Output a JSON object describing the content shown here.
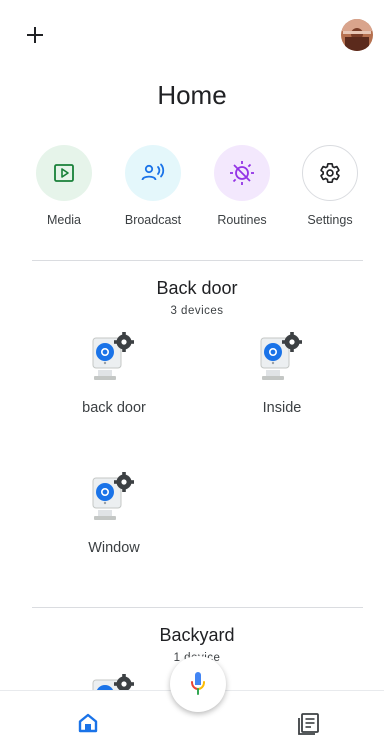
{
  "header": {
    "title": "Home"
  },
  "quick_actions": [
    {
      "label": "Media",
      "icon": "play-icon"
    },
    {
      "label": "Broadcast",
      "icon": "broadcast-icon"
    },
    {
      "label": "Routines",
      "icon": "routines-icon"
    },
    {
      "label": "Settings",
      "icon": "gear-icon"
    }
  ],
  "rooms": [
    {
      "name": "Back door",
      "count": "3 devices",
      "devices": [
        {
          "name": "back door",
          "icon": "camera-icon"
        },
        {
          "name": "Inside",
          "icon": "camera-icon"
        },
        {
          "name": "Window",
          "icon": "camera-icon"
        }
      ]
    },
    {
      "name": "Backyard",
      "count": "1 device",
      "devices": [
        {
          "name": "",
          "icon": "camera-icon"
        }
      ]
    }
  ],
  "bottom_nav": {
    "items": [
      {
        "name": "home",
        "icon": "home-icon"
      },
      {
        "name": "feed",
        "icon": "feed-icon"
      }
    ]
  },
  "colors": {
    "media_bg": "#e6f4ea",
    "media_fg": "#188038",
    "broadcast_bg": "#e4f7fb",
    "broadcast_fg": "#1a73e8",
    "routines_bg": "#f3e8fd",
    "routines_fg": "#9334e6",
    "settings_border": "#dadce0",
    "accent_blue": "#1a73e8"
  }
}
